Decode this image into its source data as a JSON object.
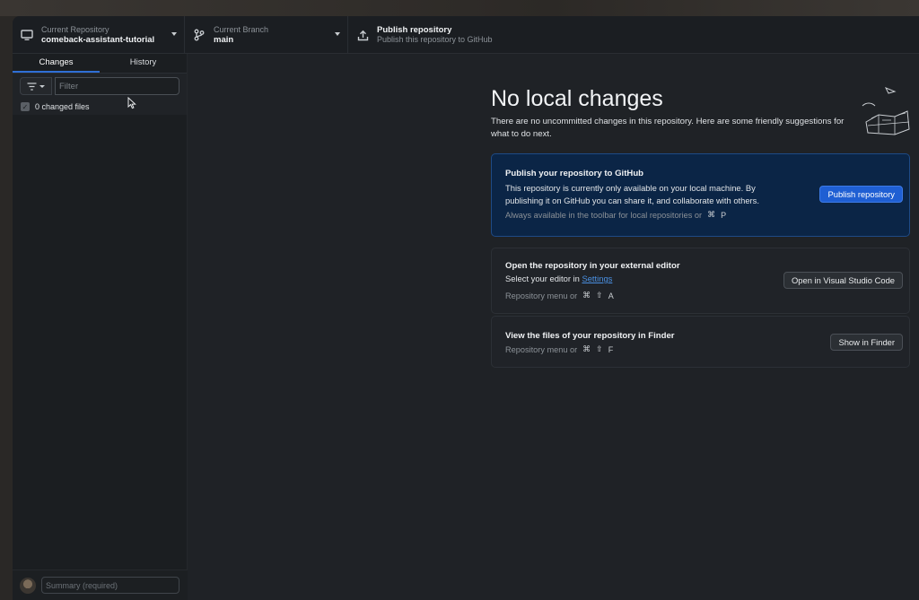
{
  "toolbar": {
    "repository": {
      "label": "Current Repository",
      "value": "comeback-assistant-tutorial"
    },
    "branch": {
      "label": "Current Branch",
      "value": "main"
    },
    "publish": {
      "title": "Publish repository",
      "subtitle": "Publish this repository to GitHub"
    }
  },
  "sidebar": {
    "tabs": [
      {
        "label": "Changes",
        "active": true
      },
      {
        "label": "History",
        "active": false
      }
    ],
    "filter_placeholder": "Filter",
    "changed_files_text": "0 changed files",
    "summary_placeholder": "Summary (required)"
  },
  "main": {
    "title": "No local changes",
    "description": "There are no uncommitted changes in this repository. Here are some friendly suggestions for what to do next.",
    "publish_card": {
      "title": "Publish your repository to GitHub",
      "text": "This repository is currently only available on your local machine. By publishing it on GitHub you can share it, and collaborate with others.",
      "hint": "Always available in the toolbar for local repositories or",
      "shortcut": [
        "⌘",
        "P"
      ],
      "button": "Publish repository"
    },
    "editor_card": {
      "title": "Open the repository in your external editor",
      "text_prefix": "Select your editor in",
      "link": "Settings",
      "hint": "Repository menu or",
      "shortcut": [
        "⌘",
        "⇧",
        "A"
      ],
      "button": "Open in Visual Studio Code"
    },
    "finder_card": {
      "title": "View the files of your repository in Finder",
      "hint": "Repository menu or",
      "shortcut": [
        "⌘",
        "⇧",
        "F"
      ],
      "button": "Show in Finder"
    }
  },
  "colors": {
    "accent": "#1f5fd3",
    "background": "#1f2226",
    "publish_card_bg": "#0b2546"
  }
}
